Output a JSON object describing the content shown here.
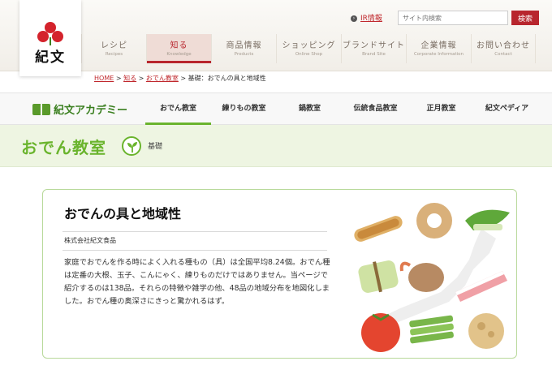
{
  "logo": {
    "text": "紀文"
  },
  "utility": {
    "ir_label": "IR情報",
    "search_placeholder": "サイト内検索",
    "search_button": "検索"
  },
  "global_nav": [
    {
      "jp": "レシピ",
      "en": "Recipes"
    },
    {
      "jp": "知る",
      "en": "Knowledge"
    },
    {
      "jp": "商品情報",
      "en": "Products"
    },
    {
      "jp": "ショッピング",
      "en": "Online Shop"
    },
    {
      "jp": "ブランドサイト",
      "en": "Brand Site"
    },
    {
      "jp": "企業情報",
      "en": "Corporate Information"
    },
    {
      "jp": "お問い合わせ",
      "en": "Contact"
    }
  ],
  "active_nav": "知る",
  "breadcrumb": {
    "home": "HOME",
    "sep1": " > ",
    "know": "知る",
    "sep2": " > ",
    "oden": "おでん教室",
    "sep3": " > ",
    "current": "基礎：おでんの具と地域性"
  },
  "academy": {
    "logo": "紀文アカデミー",
    "tabs": [
      "おでん教室",
      "練りもの教室",
      "鍋教室",
      "伝統食品教室",
      "正月教室",
      "紀文ペディア"
    ],
    "active_tab": "おでん教室"
  },
  "category": {
    "title": "おでん教室",
    "sub": "基礎"
  },
  "article": {
    "title": "おでんの具と地域性",
    "author": "株式会社紀文食品",
    "body": "家庭でおでんを作る時によく入れる種もの（具）は全国平均8.24個。おでん種は定番の大根、玉子、こんにゃく、練りものだけではありません。当ページで紹介するのは138品。それらの特徴や雑学の他、48品の地域分布を地図化しました。おでん種の奥深さにきっと驚かれるはず。"
  },
  "colors": {
    "brand_red": "#b8262e",
    "academy_green": "#6ab42d",
    "band_green": "#eef5e2"
  }
}
